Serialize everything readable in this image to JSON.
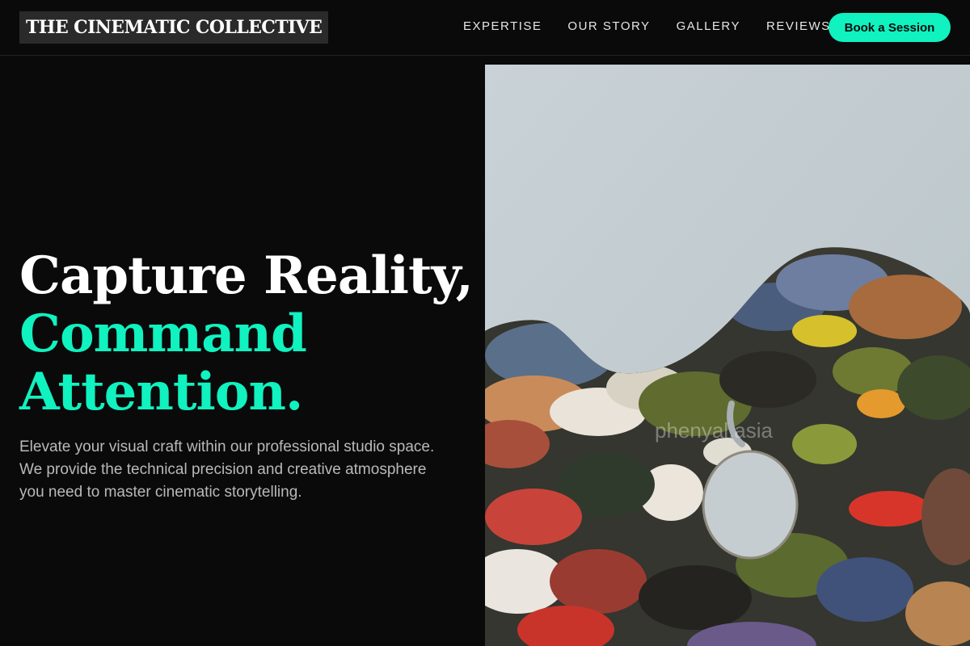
{
  "header": {
    "logo": "THE CINEMATIC COLLECTIVE",
    "nav": [
      {
        "label": "EXPERTISE"
      },
      {
        "label": "OUR STORY"
      },
      {
        "label": "GALLERY"
      },
      {
        "label": "REVIEWS"
      }
    ],
    "cta_label": "Book a Session"
  },
  "hero": {
    "title_line1": "Capture Reality,",
    "title_line2": "Command",
    "title_line3": "Attention.",
    "subtitle": "Elevate your visual craft within our professional studio space. We provide the technical precision and creative atmosphere you need to master cinematic storytelling.",
    "image_watermark": "phenyal.asia"
  },
  "colors": {
    "accent": "#10f2c0",
    "background": "#0a0a0a",
    "text_muted": "#b9b9b9"
  }
}
